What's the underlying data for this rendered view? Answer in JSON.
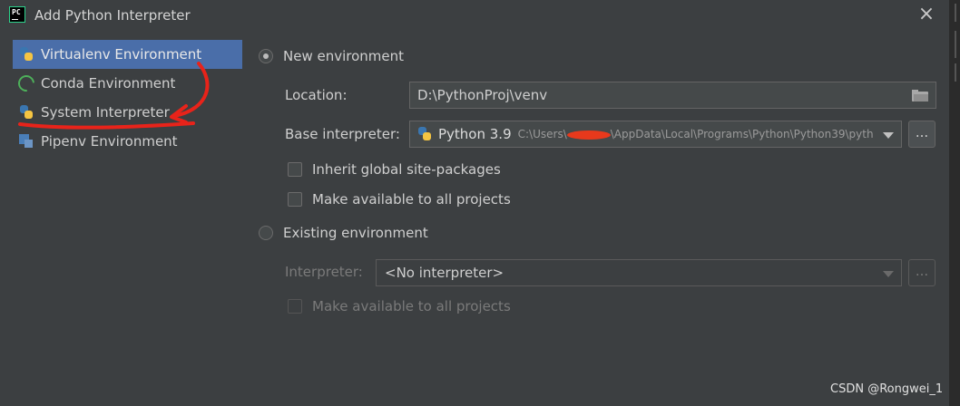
{
  "window": {
    "title": "Add Python Interpreter",
    "app_icon_text": "PC"
  },
  "sidebar": {
    "items": [
      {
        "label": "Virtualenv Environment",
        "icon": "python-icon",
        "selected": true
      },
      {
        "label": "Conda Environment",
        "icon": "conda-icon",
        "selected": false
      },
      {
        "label": "System Interpreter",
        "icon": "python-icon",
        "selected": false
      },
      {
        "label": "Pipenv Environment",
        "icon": "pipenv-icon",
        "selected": false
      }
    ]
  },
  "new_env": {
    "radio_label": "New environment",
    "selected": true,
    "location_label": "Location:",
    "location_value": "D:\\PythonProj\\venv",
    "base_label": "Base interpreter:",
    "base_version": "Python 3.9",
    "base_path_prefix": "C:\\Users\\",
    "base_path_suffix": "\\AppData\\Local\\Programs\\Python\\Python39\\pyth",
    "browse_label": "...",
    "inherit_label": "Inherit global site-packages",
    "make_available_label": "Make available to all projects"
  },
  "existing_env": {
    "radio_label": "Existing environment",
    "selected": false,
    "interpreter_label": "Interpreter:",
    "interpreter_value": "<No interpreter>",
    "browse_label": "...",
    "make_available_label": "Make available to all projects"
  },
  "watermark": "CSDN @Rongwei_1",
  "colors": {
    "selection": "#4a6ea9",
    "background": "#3c3f41",
    "annotation": "#e8231a"
  }
}
